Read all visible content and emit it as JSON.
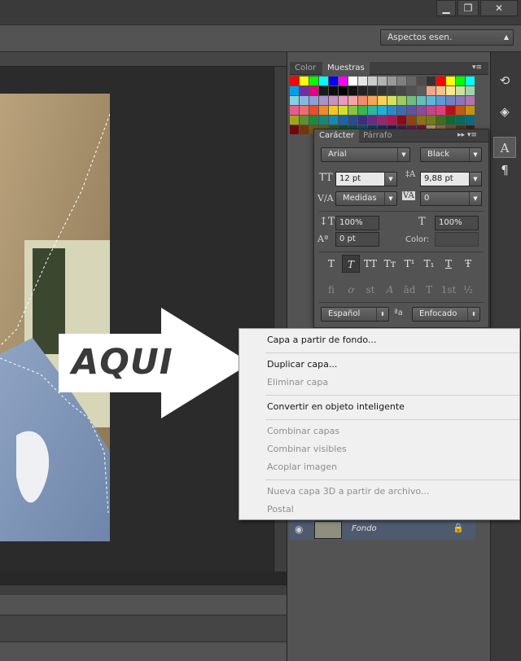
{
  "window": {
    "minimize_glyph": "▁",
    "restore_glyph": "❐",
    "close_glyph": "✕"
  },
  "options_bar": {
    "workspace_value": "Aspectos esen."
  },
  "color_panel": {
    "tabs": [
      "Color",
      "Muestras"
    ],
    "active_tab": "Muestras",
    "swatch_rows": [
      [
        "#ff0000",
        "#ffff00",
        "#00ff00",
        "#00ffff",
        "#0000ff",
        "#ff00ff",
        "#ffffff",
        "#e5e5e5",
        "#cccccc",
        "#b2b2b2",
        "#999999",
        "#808080",
        "#666666",
        "#4d4d4d",
        "#333333",
        "#ff0000",
        "#ffff00",
        "#00ff00",
        "#00ffff"
      ],
      [
        "#00a0e9",
        "#7030a0",
        "#e4007f",
        "#1a1a1a",
        "#0d0d0d",
        "#000000",
        "#111111",
        "#222222",
        "#2a2a2a",
        "#333333",
        "#3d3d3d",
        "#474747",
        "#525252",
        "#5c5c5c",
        "#f4a58a",
        "#f7c08c",
        "#fde68a",
        "#c8e39b",
        "#9fd4a8"
      ],
      [
        "#84cfe0",
        "#88b8e2",
        "#8f9fd4",
        "#a892c8",
        "#c592c4",
        "#e999c0",
        "#f6a3a5",
        "#f28b6b",
        "#f5a559",
        "#f9d254",
        "#d6e25c",
        "#9ccd5a",
        "#6cc07a",
        "#60c1b6",
        "#5bb8dc",
        "#5b9bd5",
        "#6d84c5",
        "#8a76b8",
        "#b173b2"
      ],
      [
        "#e95a8c",
        "#ec6d6c",
        "#e94d2c",
        "#ef8b22",
        "#f7c81a",
        "#d3df2b",
        "#88c43f",
        "#3cb54a",
        "#2eb89e",
        "#1fb0d8",
        "#2a8bcc",
        "#3f6bb4",
        "#5c53a2",
        "#8d4b9e",
        "#c5438f",
        "#e0407a",
        "#b8111a",
        "#c25a15",
        "#c49312"
      ],
      [
        "#a1a618",
        "#5c8f2f",
        "#1c8a3e",
        "#138a76",
        "#0f8ab2",
        "#1a64a6",
        "#2a4a92",
        "#3b2f7e",
        "#662d82",
        "#95286e",
        "#b0164f",
        "#8c0b14",
        "#91420e",
        "#917010",
        "#777a13",
        "#436b22",
        "#14682f",
        "#0e6859",
        "#0b6984"
      ],
      [
        "#700810",
        "#74350a",
        "#725a0c",
        "#5d610f",
        "#34561b",
        "#0f5326",
        "#0a5346",
        "#09536a",
        "#0e3c6a",
        "#1b2d5e",
        "#261c52",
        "#441d55",
        "#651a49",
        "#7a0f37",
        "#b9936c",
        "#8e6b4a",
        "#6e4f34",
        "#4f3622",
        "#3a2716"
      ]
    ]
  },
  "character_panel": {
    "tabs": [
      "Carácter",
      "Párrafo"
    ],
    "active_tab": "Carácter",
    "font_family": "Arial",
    "font_style": "Black",
    "font_size": "12 pt",
    "leading": "9,88 pt",
    "kerning": "Medidas",
    "tracking": "0",
    "vertical_scale": "100%",
    "horizontal_scale": "100%",
    "baseline_shift": "0 pt",
    "color_label": "Color:",
    "style_buttons": [
      "T",
      "T",
      "TT",
      "Tт",
      "T¹",
      "T₁",
      "T",
      "Ŧ"
    ],
    "opentype_buttons": [
      "fi",
      "ơ",
      "st",
      "A",
      "ād",
      "T",
      "1st",
      "½"
    ],
    "language": "Español",
    "antialias_icon": "ªa",
    "antialias": "Enfocado"
  },
  "layers": {
    "layer_name": "Fondo"
  },
  "context_menu": {
    "items": [
      {
        "label": "Capa a partir de fondo...",
        "enabled": true
      },
      {
        "label": "Duplicar capa...",
        "enabled": true
      },
      {
        "label": "Eliminar capa",
        "enabled": false
      },
      {
        "label": "Convertir en objeto inteligente",
        "enabled": true
      },
      {
        "label": "Combinar capas",
        "enabled": false
      },
      {
        "label": "Combinar visibles",
        "enabled": false
      },
      {
        "label": "Acoplar imagen",
        "enabled": false
      },
      {
        "label": "Nueva capa 3D a partir de archivo...",
        "enabled": false
      },
      {
        "label": "Postal",
        "enabled": false
      }
    ]
  },
  "annotation": {
    "text": "AQUI"
  },
  "icons": {
    "history": "history-icon",
    "properties": "cube-properties-icon",
    "character": "character-icon",
    "paragraph": "paragraph-icon",
    "visibility": "eye-icon",
    "lock": "lock-icon"
  }
}
